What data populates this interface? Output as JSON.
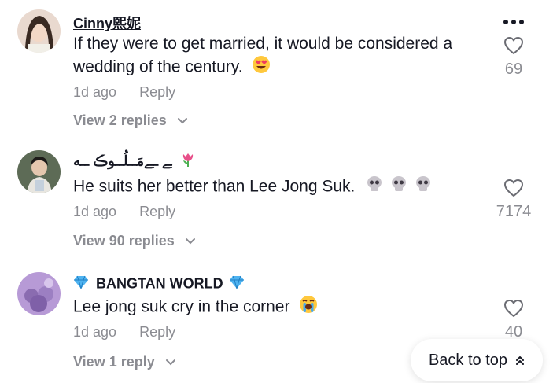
{
  "comments": [
    {
      "username": "Cinny熙妮",
      "text": "If they were to get married, it would be considered a wedding of the century.",
      "emoji": "heart-eyes-emoji",
      "time": "1d ago",
      "reply_label": "Reply",
      "likes": "69",
      "view_replies": "View 2 replies"
    },
    {
      "username": "ﮯ ـﮯمَــلُــوڪ ــه",
      "username_emoji": "tulip-emoji",
      "text": "He suits her better than Lee Jong Suk.",
      "emoji": "skull-emoji ×3",
      "time": "1d ago",
      "reply_label": "Reply",
      "likes": "7174",
      "view_replies": "View 90 replies"
    },
    {
      "username": "BANGTAN WORLD",
      "username_emoji": "gem-emoji",
      "text": "Lee jong suk cry in the corner",
      "emoji": "loudly-crying-emoji",
      "time": "1d ago",
      "reply_label": "Reply",
      "likes": "40",
      "view_replies": "View 1 reply"
    }
  ],
  "back_to_top": "Back to top",
  "colors": {
    "text": "#161823",
    "muted": "rgba(22,24,35,0.5)",
    "background": "#ffffff"
  }
}
